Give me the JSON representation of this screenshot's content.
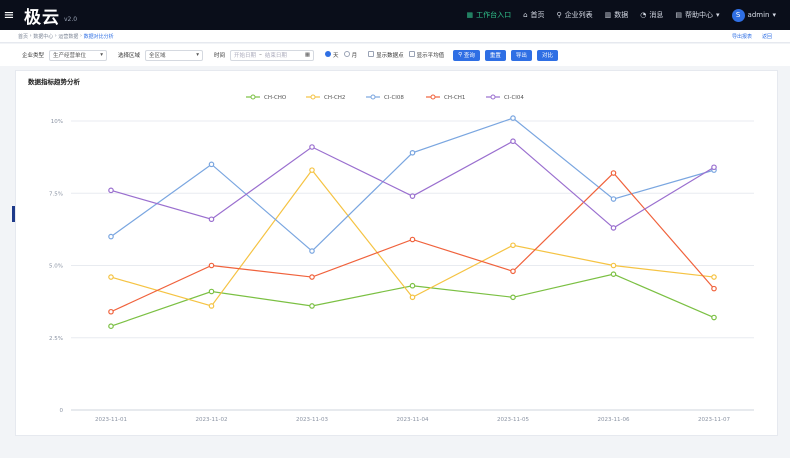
{
  "topbar": {
    "app_name": "极云",
    "app_sub": "v2.0",
    "nav": [
      {
        "label": "工作台入口",
        "icon": "grid-icon",
        "accent": true
      },
      {
        "label": "首页",
        "icon": "home-icon"
      },
      {
        "label": "企业列表",
        "icon": "search-icon"
      },
      {
        "label": "数据",
        "icon": "chart-icon"
      },
      {
        "label": "消息",
        "icon": "bell-icon"
      },
      {
        "label": "帮助中心",
        "icon": "book-icon"
      }
    ],
    "user": {
      "initial": "S",
      "name": "admin"
    }
  },
  "breadcrumb": {
    "items": [
      "首页",
      "数据中心",
      "运营数据"
    ],
    "current": "数据对比分析",
    "right": [
      "导出报表",
      "返回"
    ]
  },
  "filters": {
    "type_label": "企业类型",
    "type_value": "生产经营单位",
    "scope_label": "选择区域",
    "scope_value": "全区域",
    "time_label": "时间",
    "date_start": "开始日期",
    "date_end": "结束日期",
    "radio_day": "天",
    "radio_month": "月",
    "check1": "显示数据点",
    "check2": "显示平均值",
    "buttons": [
      "查询",
      "重置",
      "导出",
      "对比"
    ]
  },
  "chart_title": "数据指标趋势分析",
  "chart_data": {
    "type": "line",
    "x": [
      "2023-11-01",
      "2023-11-02",
      "2023-11-03",
      "2023-11-04",
      "2023-11-05",
      "2023-11-06",
      "2023-11-07"
    ],
    "ylim": [
      0,
      10
    ],
    "yticks": [
      "0",
      "2.5%",
      "5.0%",
      "7.5%",
      "10%"
    ],
    "ytick_values": [
      0,
      2.5,
      5,
      7.5,
      10
    ],
    "grid": true,
    "legend_position": "top",
    "series": [
      {
        "name": "CH-CHO",
        "color": "#7bc043",
        "values": [
          2.9,
          4.1,
          3.6,
          4.3,
          3.9,
          4.7,
          3.2
        ]
      },
      {
        "name": "CH-CH2",
        "color": "#f5c343",
        "values": [
          4.6,
          3.6,
          8.3,
          3.9,
          5.7,
          5.0,
          4.6
        ]
      },
      {
        "name": "CI-CI08",
        "color": "#7aa6e0",
        "values": [
          6.0,
          8.5,
          5.5,
          8.9,
          10.1,
          7.3,
          8.3
        ]
      },
      {
        "name": "CH-CH1",
        "color": "#f0623c",
        "values": [
          3.4,
          5.0,
          4.6,
          5.9,
          4.8,
          8.2,
          4.2
        ]
      },
      {
        "name": "CI-CI04",
        "color": "#9a6fcf",
        "values": [
          7.6,
          6.6,
          9.1,
          7.4,
          9.3,
          6.3,
          8.4
        ]
      }
    ]
  }
}
